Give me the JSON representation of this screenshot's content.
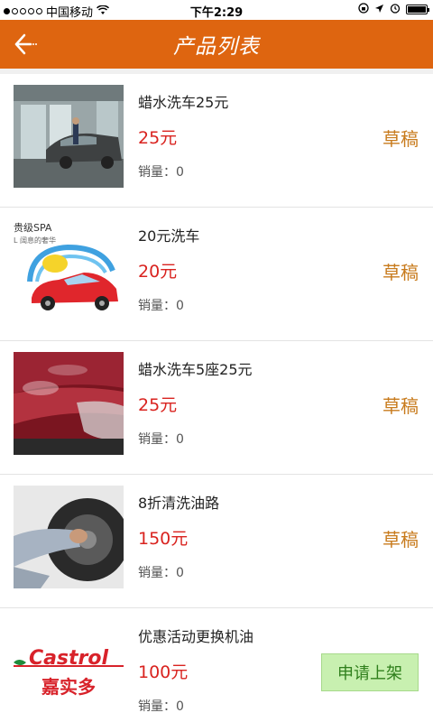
{
  "status_bar": {
    "carrier": "中国移动",
    "time": "下午2:29"
  },
  "nav": {
    "title": "产品列表"
  },
  "products": [
    {
      "name": "蜡水洗车25元",
      "price": "25元",
      "sales_label": "销量：0",
      "status": "草稿",
      "image": "car-wash-garage"
    },
    {
      "name": "20元洗车",
      "price": "20元",
      "sales_label": "销量：0",
      "status": "草稿",
      "image": "spa-car-logo",
      "image_text_1": "贵级SPA",
      "image_text_2": "L 阔息的奢华"
    },
    {
      "name": "蜡水洗车5座25元",
      "price": "25元",
      "sales_label": "销量：0",
      "status": "草稿",
      "image": "red-car-foam"
    },
    {
      "name": "8折清洗油路",
      "price": "150元",
      "sales_label": "销量：0",
      "status": "草稿",
      "image": "tire-service"
    },
    {
      "name": "优惠活动更换机油",
      "price": "100元",
      "sales_label": "销量：0",
      "action": "申请上架",
      "image": "castrol-logo",
      "image_text_1": "Castrol",
      "image_text_2": "嘉实多"
    }
  ],
  "colors": {
    "nav_bg": "#de6510",
    "price": "#d9231f",
    "status": "#c87b1d",
    "apply_bg": "#c8f0b0"
  }
}
